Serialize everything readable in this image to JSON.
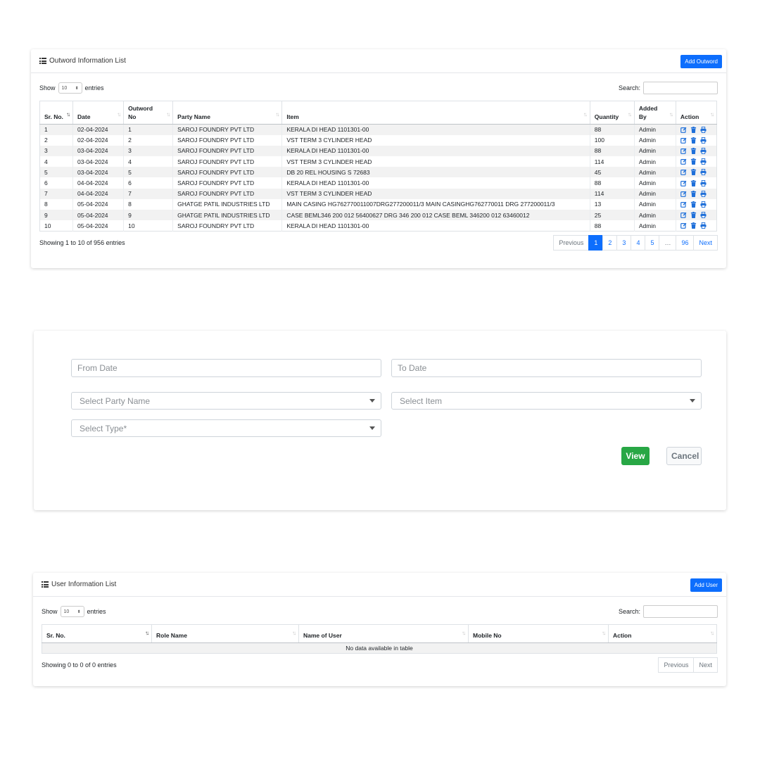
{
  "outword": {
    "title": "Outword Information List",
    "add_button": "Add Outword",
    "show_label": "Show",
    "entries_label": "entries",
    "page_length": "10",
    "search_label": "Search:",
    "columns": [
      "Sr. No.",
      "Date",
      "Outword No",
      "Party Name",
      "Item",
      "Quantity",
      "Added By",
      "Action"
    ],
    "rows": [
      [
        "1",
        "02-04-2024",
        "1",
        "SAROJ FOUNDRY PVT LTD",
        "KERALA DI HEAD 1101301-00",
        "88",
        "Admin"
      ],
      [
        "2",
        "02-04-2024",
        "2",
        "SAROJ FOUNDRY PVT LTD",
        "VST TERM 3 CYLINDER HEAD",
        "100",
        "Admin"
      ],
      [
        "3",
        "03-04-2024",
        "3",
        "SAROJ FOUNDRY PVT LTD",
        "KERALA DI HEAD 1101301-00",
        "88",
        "Admin"
      ],
      [
        "4",
        "03-04-2024",
        "4",
        "SAROJ FOUNDRY PVT LTD",
        "VST TERM 3 CYLINDER HEAD",
        "114",
        "Admin"
      ],
      [
        "5",
        "03-04-2024",
        "5",
        "SAROJ FOUNDRY PVT LTD",
        "DB 20 REL HOUSING S 72683",
        "45",
        "Admin"
      ],
      [
        "6",
        "04-04-2024",
        "6",
        "SAROJ FOUNDRY PVT LTD",
        "KERALA DI HEAD 1101301-00",
        "88",
        "Admin"
      ],
      [
        "7",
        "04-04-2024",
        "7",
        "SAROJ FOUNDRY PVT LTD",
        "VST TERM 3 CYLINDER HEAD",
        "114",
        "Admin"
      ],
      [
        "8",
        "05-04-2024",
        "8",
        "GHATGE PATIL INDUSTRIES LTD",
        "MAIN CASING HG762770011007DRG277200011/3 MAIN CASINGHG762770011 DRG 277200011/3",
        "13",
        "Admin"
      ],
      [
        "9",
        "05-04-2024",
        "9",
        "GHATGE PATIL INDUSTRIES LTD",
        "CASE BEML346 200 012 56400627 DRG 346 200 012 CASE BEML 346200 012 63460012",
        "25",
        "Admin"
      ],
      [
        "10",
        "05-04-2024",
        "10",
        "SAROJ FOUNDRY PVT LTD",
        "KERALA DI HEAD 1101301-00",
        "88",
        "Admin"
      ]
    ],
    "info": "Showing 1 to 10 of 956 entries",
    "pagination": [
      "Previous",
      "1",
      "2",
      "3",
      "4",
      "5",
      "…",
      "96",
      "Next"
    ]
  },
  "filter": {
    "from_date_placeholder": "From Date",
    "to_date_placeholder": "To Date",
    "party_placeholder": "Select Party Name",
    "item_placeholder": "Select Item",
    "type_placeholder": "Select Type*",
    "view_label": "View",
    "cancel_label": "Cancel"
  },
  "user": {
    "title": "User Information List",
    "add_button": "Add User",
    "show_label": "Show",
    "entries_label": "entries",
    "page_length": "10",
    "search_label": "Search:",
    "columns": [
      "Sr. No.",
      "Role Name",
      "Name of User",
      "Mobile No",
      "Action"
    ],
    "empty_message": "No data available in table",
    "info": "Showing 0 to 0 of 0 entries",
    "pagination": [
      "Previous",
      "Next"
    ]
  },
  "colors": {
    "primary": "#0d6efd",
    "success": "#28a745",
    "icon_blue": "#1e6fd9"
  },
  "icons": {
    "title": "list-icon",
    "row_actions": [
      "edit-icon",
      "trash-icon",
      "print-icon"
    ]
  }
}
